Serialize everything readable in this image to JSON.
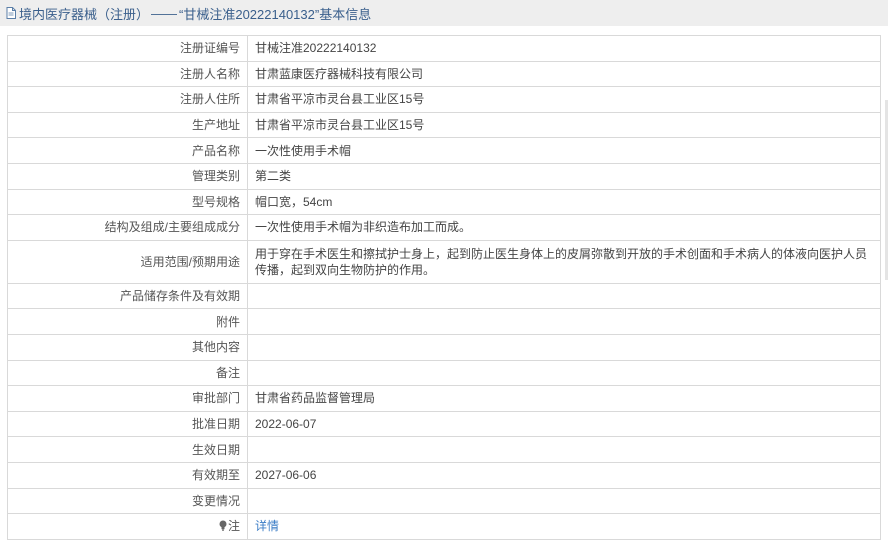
{
  "title": {
    "category": "境内医疗器械（注册）",
    "separator": "——",
    "record": "“甘械注准20222140132”基本信息"
  },
  "rows": [
    {
      "label": "注册证编号",
      "value": "甘械注准20222140132"
    },
    {
      "label": "注册人名称",
      "value": "甘肃蓝康医疗器械科技有限公司"
    },
    {
      "label": "注册人住所",
      "value": "甘肃省平凉市灵台县工业区15号"
    },
    {
      "label": "生产地址",
      "value": "甘肃省平凉市灵台县工业区15号"
    },
    {
      "label": "产品名称",
      "value": "一次性使用手术帽"
    },
    {
      "label": "管理类别",
      "value": "第二类"
    },
    {
      "label": "型号规格",
      "value": "帽口宽，54cm"
    },
    {
      "label": "结构及组成/主要组成成分",
      "value": "一次性使用手术帽为非织造布加工而成。"
    },
    {
      "label": "适用范围/预期用途",
      "value": "用于穿在手术医生和擦拭护士身上，起到防止医生身体上的皮屑弥散到开放的手术创面和手术病人的体液向医护人员传播，起到双向生物防护的作用。"
    },
    {
      "label": "产品储存条件及有效期",
      "value": ""
    },
    {
      "label": "附件",
      "value": ""
    },
    {
      "label": "其他内容",
      "value": ""
    },
    {
      "label": "备注",
      "value": ""
    },
    {
      "label": "审批部门",
      "value": "甘肃省药品监督管理局"
    },
    {
      "label": "批准日期",
      "value": "2022-06-07"
    },
    {
      "label": "生效日期",
      "value": ""
    },
    {
      "label": "有效期至",
      "value": "2027-06-06"
    },
    {
      "label": "变更情况",
      "value": ""
    }
  ],
  "note": {
    "label": "注",
    "link": "详情",
    "icon": "lightbulb-icon"
  },
  "colors": {
    "title_text": "#3a5f8c",
    "link": "#3a7cc6",
    "border": "#d9d9d9",
    "header_bg": "#eeeeee"
  }
}
